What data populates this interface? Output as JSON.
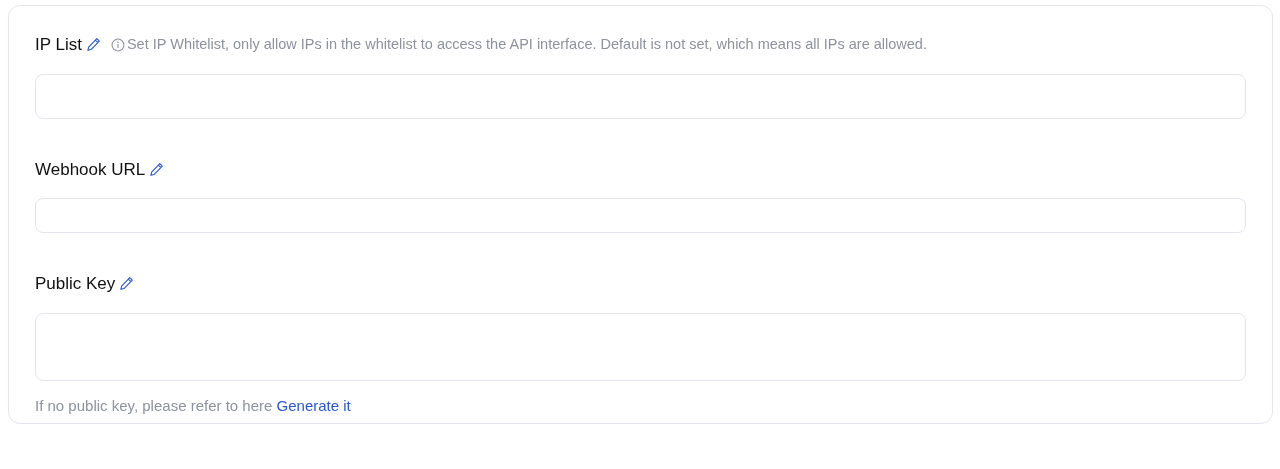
{
  "fields": [
    {
      "label": "IP List",
      "hint": "Set IP Whitelist, only allow IPs in the whitelist to access the API interface. Default is not set, which means all IPs are allowed.",
      "kind": "textarea-short"
    },
    {
      "label": "Webhook URL",
      "kind": "input"
    },
    {
      "label": "Public Key",
      "kind": "textarea-tall",
      "note": "If no public key, please refer to here",
      "note_link": "Generate it"
    }
  ]
}
